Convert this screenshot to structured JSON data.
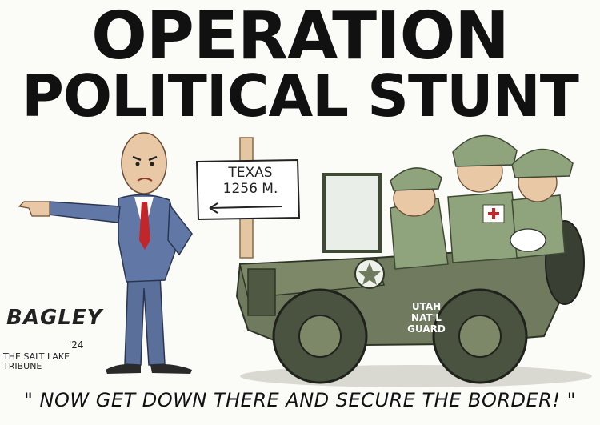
{
  "headline": {
    "line1": "OPERATION",
    "line2": "POLITICAL STUNT"
  },
  "sign": {
    "line1": "TEXAS",
    "line2": "1256 M."
  },
  "jeep": {
    "line1": "UTAH",
    "line2": "NAT'L",
    "line3": "GUARD"
  },
  "signature": {
    "name": "BAGLEY",
    "year": "'24",
    "paper": "THE SALT LAKE TRIBUNE"
  },
  "caption": "\" NOW GET DOWN THERE AND SECURE THE BORDER! \"",
  "colors": {
    "jeep_green": "#6f7a5e",
    "soldier_green": "#8fa47c",
    "suit_blue": "#5f77a3",
    "tie_red": "#c0262a",
    "skin": "#e9c8a6"
  }
}
